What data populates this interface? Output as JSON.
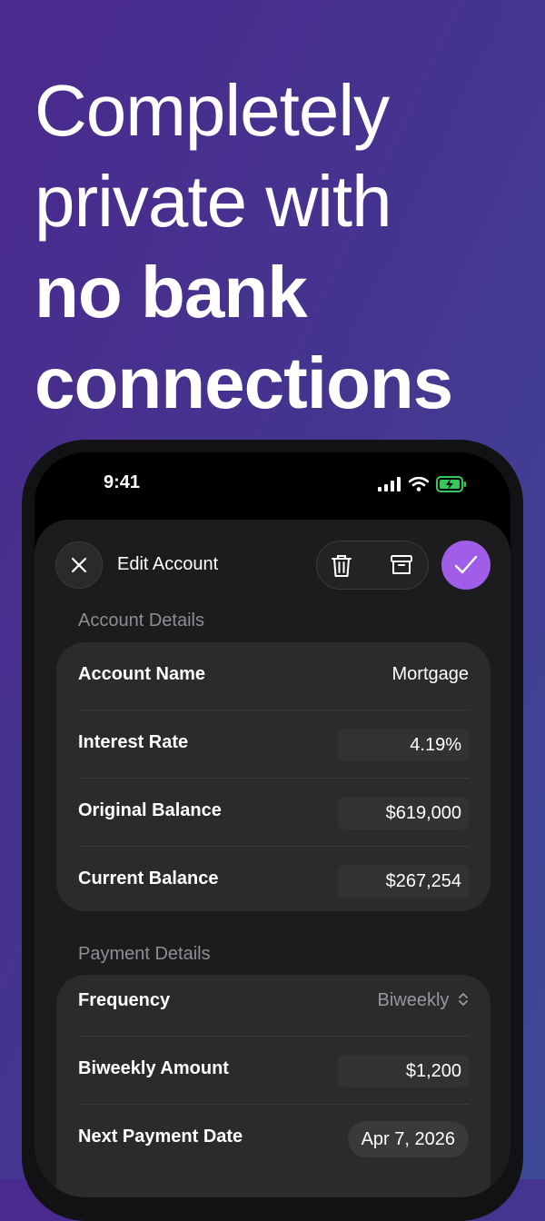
{
  "headline": {
    "line1": "Completely",
    "line2": "private with",
    "line3": "no bank",
    "line4": "connections"
  },
  "status_bar": {
    "time": "9:41",
    "icons": [
      "signal-icon",
      "wifi-icon",
      "battery-charging-icon"
    ]
  },
  "sheet": {
    "title": "Edit Account",
    "close_icon": "close-icon",
    "actions": [
      "trash-icon",
      "archive-icon"
    ],
    "confirm_icon": "checkmark-icon"
  },
  "account_details": {
    "title": "Account Details",
    "rows": [
      {
        "label": "Account Name",
        "value": "Mortgage"
      },
      {
        "label": "Interest Rate",
        "value": "4.19%"
      },
      {
        "label": "Original Balance",
        "value": "$619,000"
      },
      {
        "label": "Current Balance",
        "value": "$267,254"
      }
    ]
  },
  "payment_details": {
    "title": "Payment Details",
    "rows": [
      {
        "label": "Frequency",
        "value": "Biweekly"
      },
      {
        "label": "Biweekly Amount",
        "value": "$1,200"
      },
      {
        "label": "Next Payment Date",
        "value": "Apr 7, 2026"
      }
    ]
  },
  "colors": {
    "accent": "#a05de8",
    "sheet_bg": "#1c1c1e",
    "card_bg": "#2b2b2e",
    "battery_green": "#34c759"
  }
}
